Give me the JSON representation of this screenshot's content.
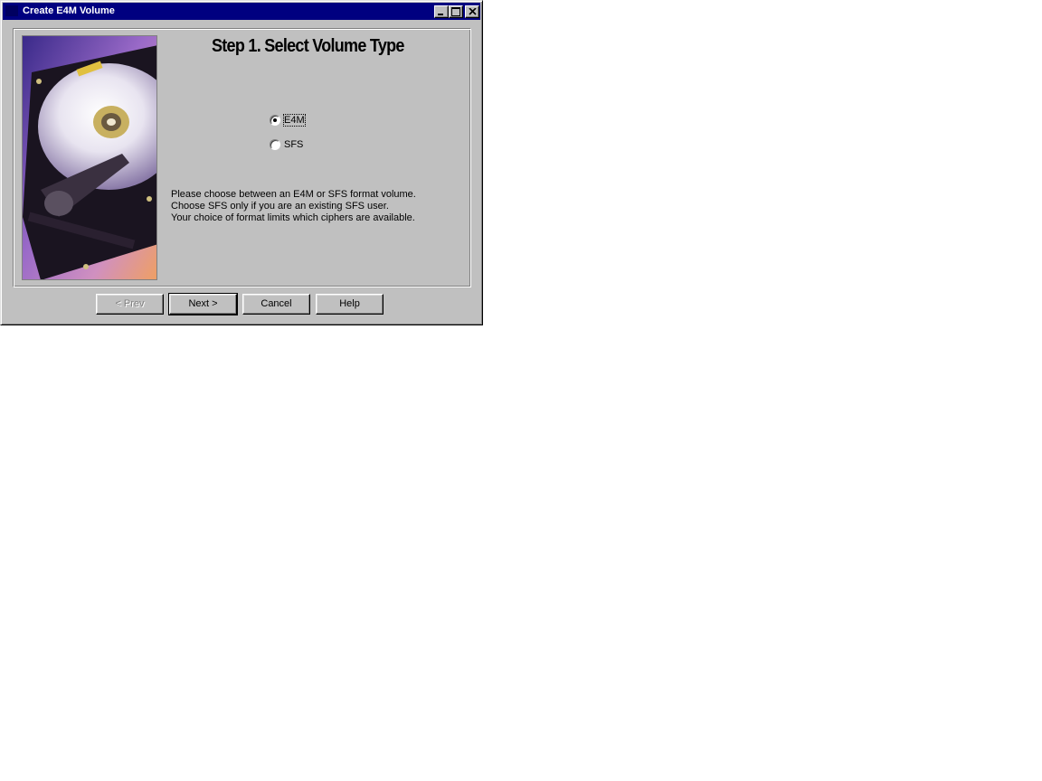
{
  "window": {
    "title": "Create E4M Volume"
  },
  "wizard": {
    "heading": "Step 1. Select Volume Type",
    "options": [
      {
        "label": "E4M",
        "selected": true
      },
      {
        "label": "SFS",
        "selected": false
      }
    ],
    "description": [
      "Please choose between an E4M or SFS format volume.",
      "Choose SFS only if you are an existing SFS user.",
      "Your choice of format limits which ciphers are available."
    ]
  },
  "buttons": {
    "prev": "< Prev",
    "next": "Next >",
    "cancel": "Cancel",
    "help": "Help"
  },
  "icons": {
    "titlebar": "app-icon",
    "minimize": "minimize-icon",
    "maximize": "maximize-icon",
    "close": "close-icon",
    "picture": "hard-drive-image"
  }
}
